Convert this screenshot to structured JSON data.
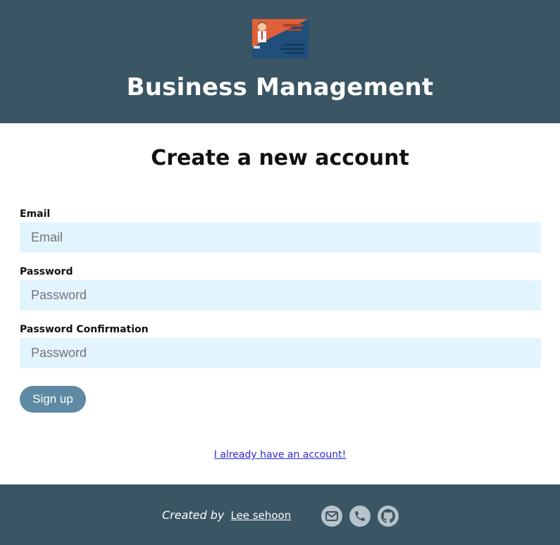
{
  "header": {
    "logo_icon": "business-card-icon",
    "title": "Business Management"
  },
  "form": {
    "heading": "Create a new account",
    "email": {
      "label": "Email",
      "placeholder": "Email",
      "value": ""
    },
    "password": {
      "label": "Password",
      "placeholder": "Password",
      "value": ""
    },
    "password_confirmation": {
      "label": "Password Confirmation",
      "placeholder": "Password",
      "value": ""
    },
    "submit_label": "Sign up",
    "login_link": "I already have an account!"
  },
  "footer": {
    "created_by": "Created by",
    "author": "Lee sehoon",
    "icons": [
      "mail-icon",
      "phone-icon",
      "github-icon"
    ]
  },
  "colors": {
    "header_bg": "#3a5563",
    "input_bg": "#e2f4fe",
    "button_bg": "#5e8aa3",
    "link": "#2b2bd0",
    "social_bg": "#b7c3ca"
  }
}
